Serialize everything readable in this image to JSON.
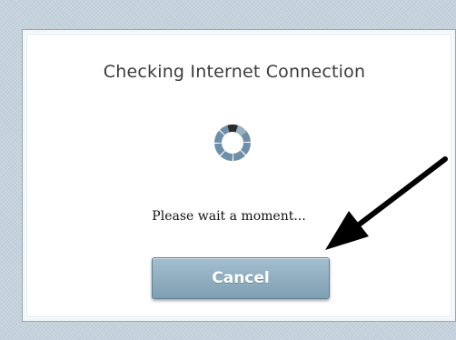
{
  "dialog": {
    "title": "Checking Internet Connection",
    "message": "Please wait a moment...",
    "cancel_label": "Cancel"
  },
  "icons": {
    "spinner": "loading-spinner-icon",
    "annotation": "arrow-icon"
  },
  "colors": {
    "button_top": "#a3bfcf",
    "button_bottom": "#7f9fb2",
    "spinner_active": "#2b2b2b",
    "spinner_inactive": "#6f8fa8"
  }
}
